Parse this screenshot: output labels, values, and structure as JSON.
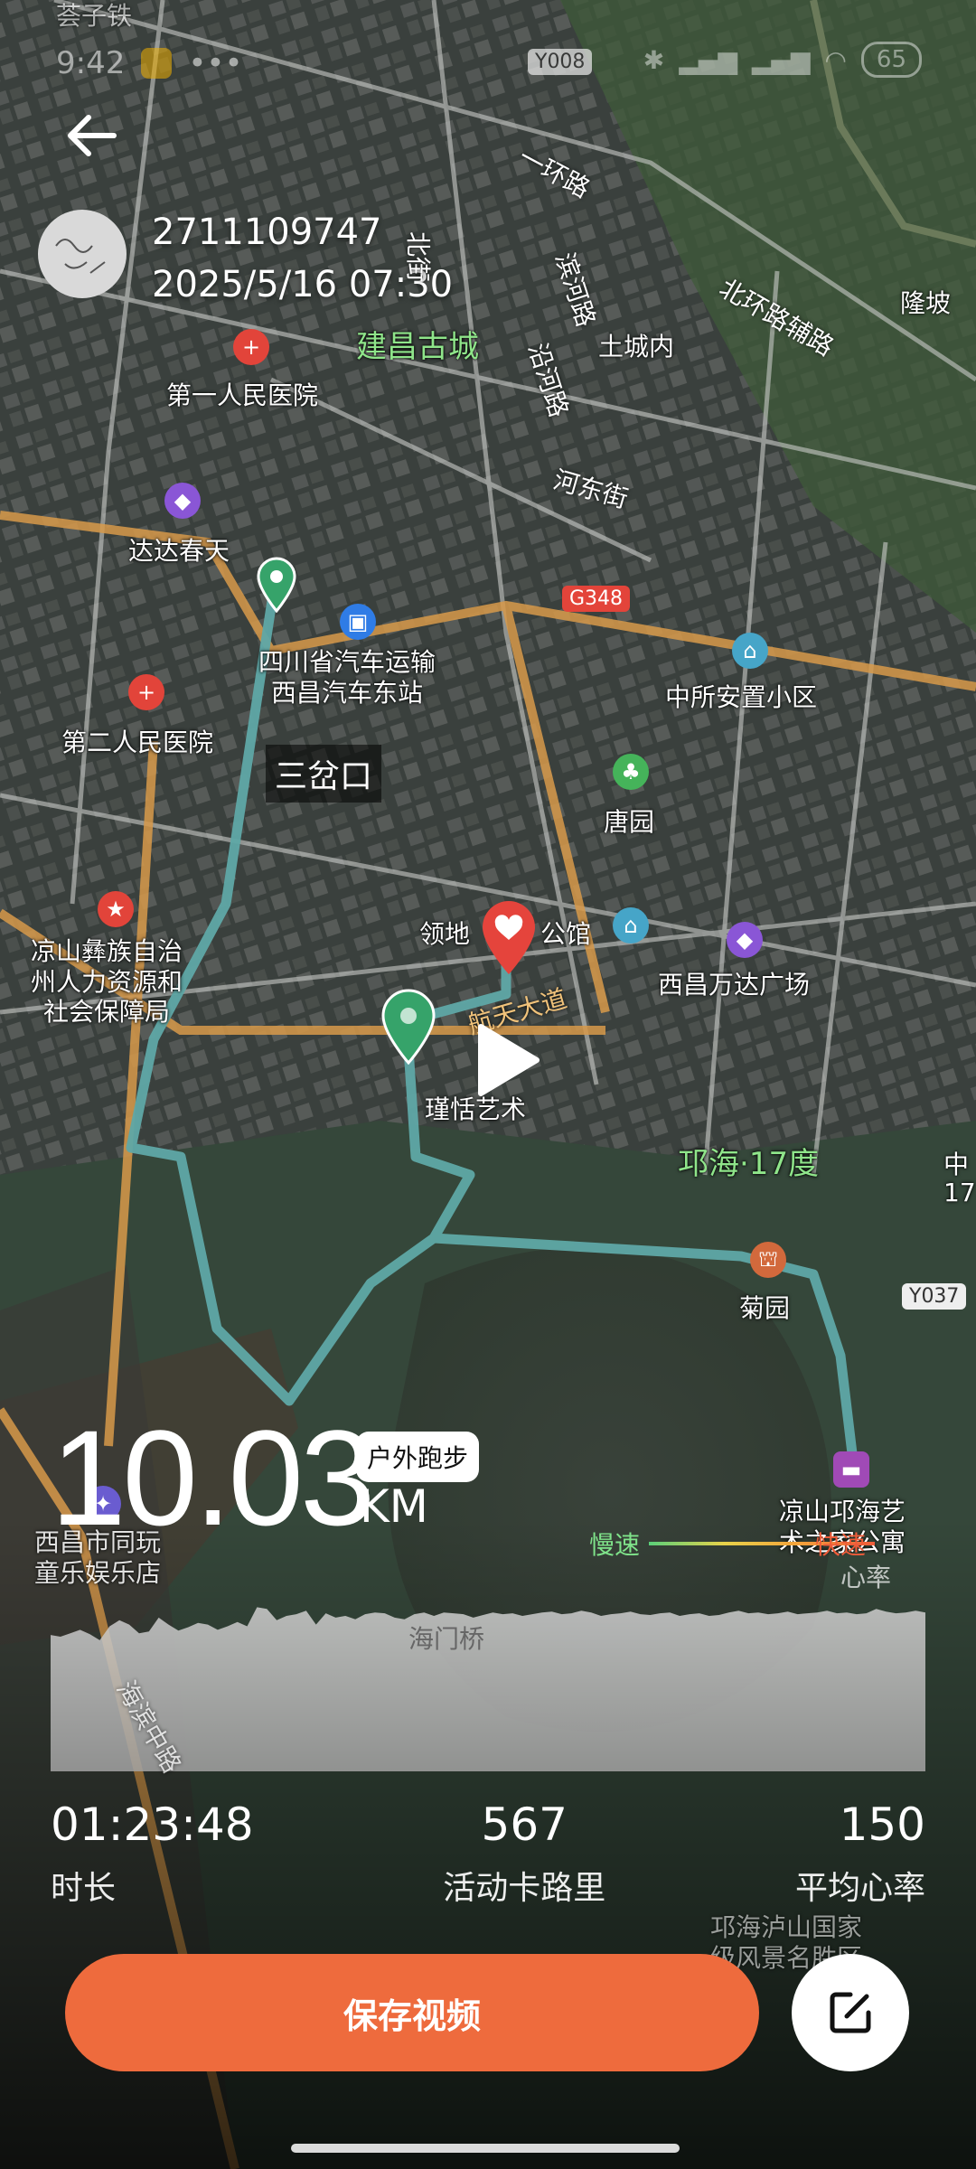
{
  "status_bar": {
    "time": "9:42",
    "battery": "65"
  },
  "header": {
    "user_id": "2711109747",
    "datetime": "2025/5/16 07:30"
  },
  "map_labels": {
    "top_left": "荟子铁",
    "road_y008": "Y008",
    "yihuan": "一环路",
    "binhe": "滨河路",
    "yanhe": "沿河路",
    "beijie": "北街",
    "beihuan": "北环路辅路",
    "longpo": "隆坡",
    "gucheng": "建昌古城",
    "tuchengnei": "土城内",
    "hospital1": "第一人民医院",
    "hedong": "河东街",
    "dadachuntian": "达达春天",
    "g348": "G348",
    "bus_station": "四川省汽车运输\n西昌汽车东站",
    "zhongsuo": "中所安置小区",
    "hospital2": "第二人民医院",
    "sanchakou": "三岔口",
    "tangyuan": "唐园",
    "lingdi": "领地",
    "gongguan": "公馆",
    "wanda": "西昌万达广场",
    "liangshan_hr": "凉山彝族自治\n州人力资源和\n社会保障局",
    "hangtian": "航天大道",
    "jintian": "瑾恬艺术",
    "qionghai17": "邛海·17度",
    "zhong17": "中\n17",
    "juyuan": "菊园",
    "y037": "Y037",
    "qionghai_art": "凉山邛海艺\n术之家公寓",
    "xichang_kids": "西昌市同玩\n童乐娱乐店",
    "haimenqiao": "海门桥",
    "haibin": "海滨中路",
    "scenic": "邛海泸山国家\n级风景名胜区"
  },
  "workout": {
    "distance": "10.03",
    "unit": "KM",
    "sport_type": "户外跑步",
    "pace_slow": "慢速",
    "pace_fast": "快速",
    "heart_rate_chart_label": "心率",
    "heart_rate_profile": [
      0.72,
      0.74,
      0.7,
      0.66,
      0.71,
      0.78,
      0.62,
      0.55,
      0.6,
      0.7,
      0.68,
      0.52,
      0.6,
      0.67,
      0.63,
      0.58,
      0.6,
      0.66,
      0.62,
      0.57,
      0.62,
      0.4,
      0.42,
      0.55,
      0.5,
      0.48,
      0.44,
      0.6,
      0.47,
      0.52,
      0.5,
      0.54,
      0.48,
      0.46,
      0.47,
      0.52,
      0.54,
      0.48,
      0.46,
      0.5,
      0.46,
      0.47,
      0.48,
      0.52,
      0.49,
      0.46,
      0.48,
      0.47,
      0.5,
      0.48,
      0.46,
      0.45,
      0.48,
      0.47,
      0.44,
      0.46,
      0.5,
      0.48,
      0.47,
      0.45,
      0.48,
      0.49,
      0.47,
      0.46,
      0.5,
      0.48,
      0.47,
      0.5,
      0.49,
      0.46,
      0.44,
      0.47,
      0.46,
      0.48,
      0.47,
      0.45,
      0.48,
      0.47,
      0.46,
      0.44,
      0.47,
      0.46,
      0.48,
      0.47,
      0.42,
      0.45,
      0.47,
      0.46,
      0.44,
      0.46
    ],
    "stats": [
      {
        "value": "01:23:48",
        "label": "时长"
      },
      {
        "value": "567",
        "label": "活动卡路里"
      },
      {
        "value": "150",
        "label": "平均心率"
      }
    ]
  },
  "actions": {
    "save_label": "保存视频"
  },
  "colors": {
    "accent": "#EE6B3D",
    "route": "#5FA8A6"
  }
}
